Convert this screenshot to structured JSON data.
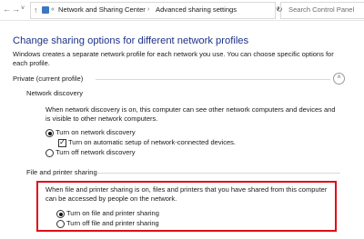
{
  "address_bar": {
    "breadcrumbs": [
      "Network and Sharing Center",
      "Advanced sharing settings"
    ],
    "search_placeholder": "Search Control Panel"
  },
  "main": {
    "heading": "Change sharing options for different network profiles",
    "intro": "Windows creates a separate network profile for each network you use. You can choose specific options for each profile."
  },
  "profile": {
    "title": "Private (current profile)"
  },
  "network_discovery": {
    "title": "Network discovery",
    "description": "When network discovery is on, this computer can see other network computers and devices and is visible to other network computers.",
    "options": [
      {
        "label": "Turn on network discovery",
        "selected": true
      },
      {
        "label": "Turn off network discovery",
        "selected": false
      }
    ],
    "auto_setup": {
      "label": "Turn on automatic setup of network-connected devices.",
      "checked": true
    }
  },
  "file_printer_sharing": {
    "title": "File and printer sharing",
    "description": "When file and printer sharing is on, files and printers that you have shared from this computer can be accessed by people on the network.",
    "options": [
      {
        "label": "Turn on file and printer sharing",
        "selected": true
      },
      {
        "label": "Turn off file and printer sharing",
        "selected": false
      }
    ]
  },
  "colors": {
    "heading": "#1e3287",
    "highlight": "#e00d16"
  }
}
